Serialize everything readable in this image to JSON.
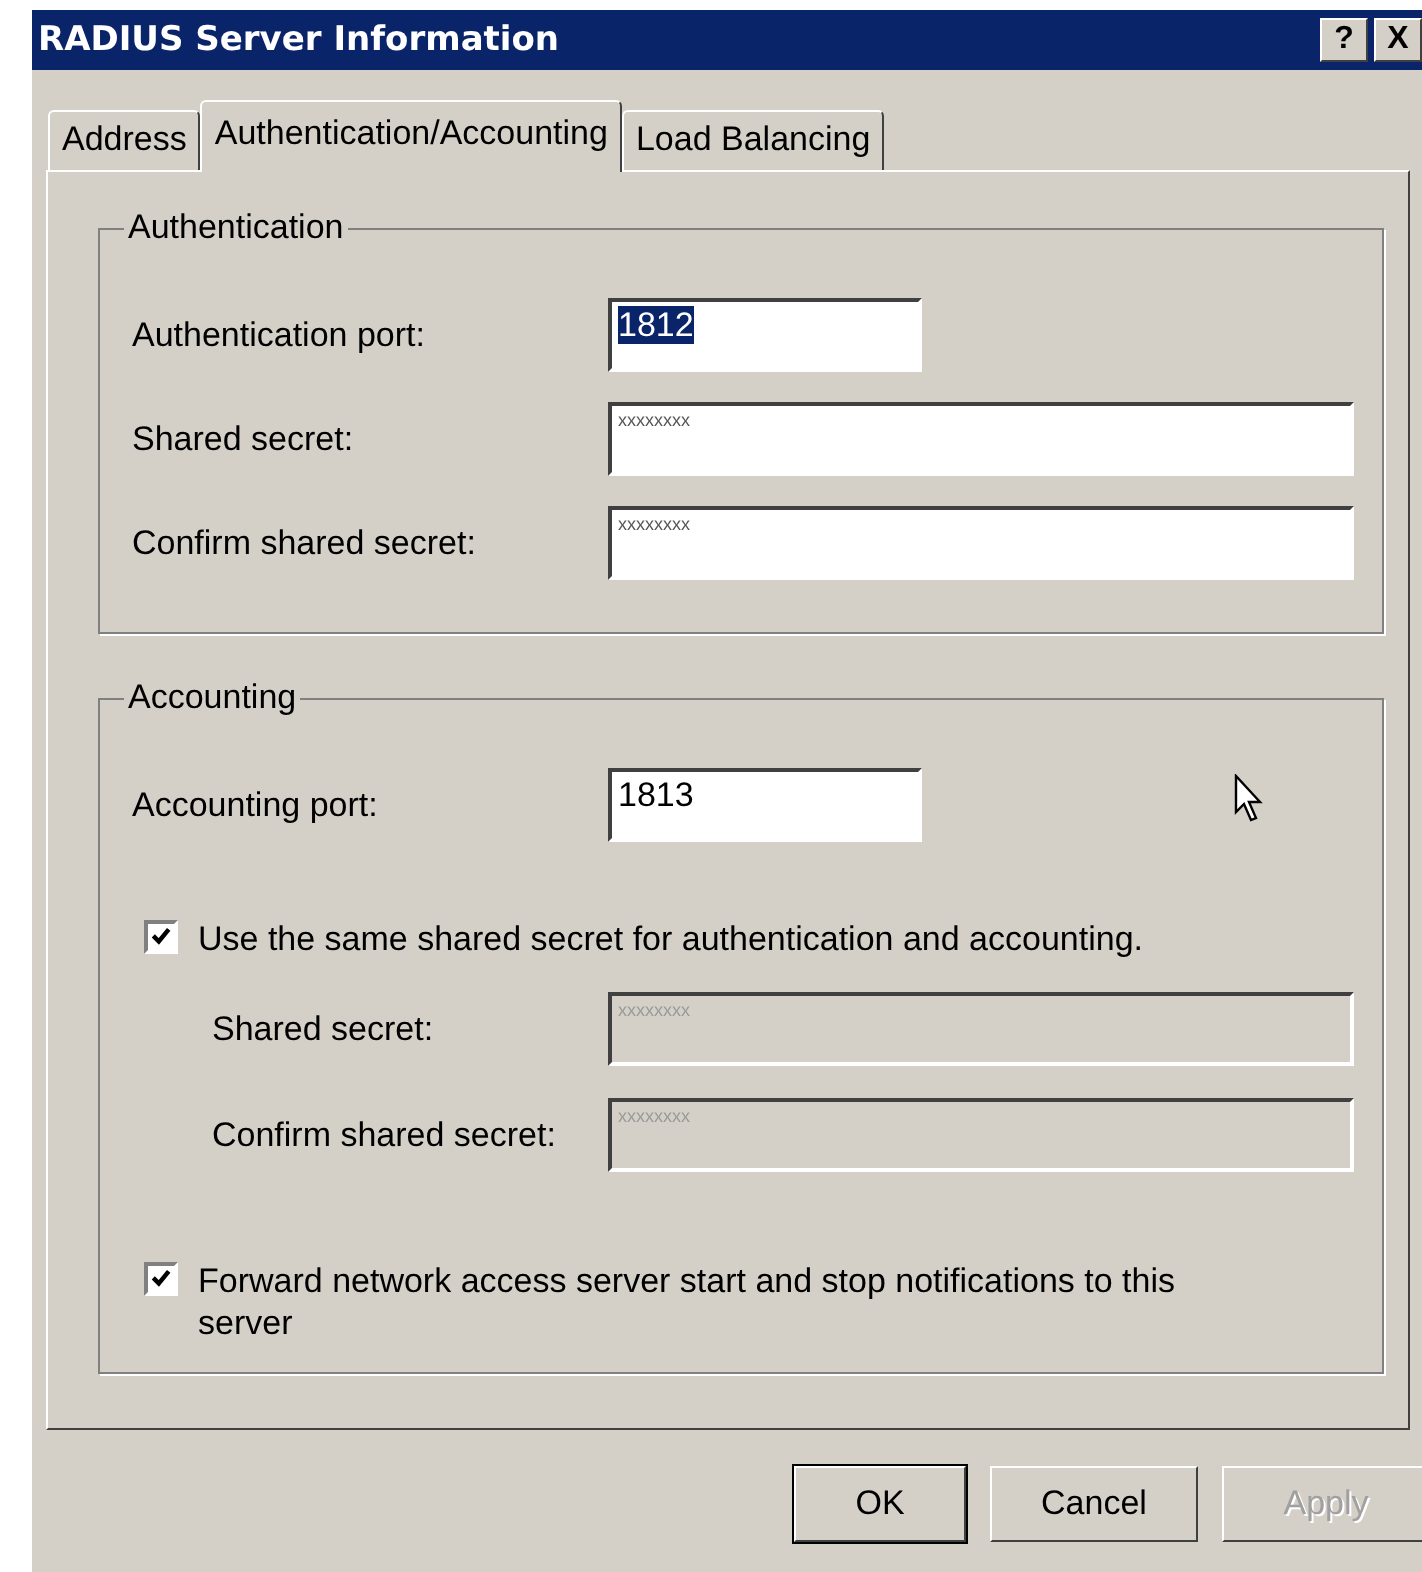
{
  "window": {
    "title": "RADIUS Server Information",
    "title_buttons": [
      "?",
      "X"
    ]
  },
  "tabs": [
    {
      "label": "Address",
      "selected": false
    },
    {
      "label": "Authentication/Accounting",
      "selected": true
    },
    {
      "label": "Load Balancing",
      "selected": false
    }
  ],
  "authentication": {
    "title": "Authentication",
    "fields": [
      {
        "label": "Authentication port:",
        "value": "1812",
        "kind": "short",
        "disabled": false,
        "highlighted": true
      },
      {
        "label": "Shared secret:",
        "value": "xxxxxxxx",
        "kind": "secret",
        "disabled": false,
        "highlighted": false
      },
      {
        "label": "Confirm shared secret:",
        "value": "xxxxxxxx",
        "kind": "secret",
        "disabled": false,
        "highlighted": false
      }
    ]
  },
  "accounting": {
    "title": "Accounting",
    "port": {
      "label": "Accounting port:",
      "value": "1813",
      "kind": "short",
      "disabled": false,
      "highlighted": false
    },
    "same_secret": {
      "label": "Use the same shared secret for authentication and accounting.",
      "checked": true
    },
    "fields": [
      {
        "label": "Shared secret:",
        "value": "xxxxxxxx",
        "kind": "secret",
        "disabled": true,
        "highlighted": false
      },
      {
        "label": "Confirm shared secret:",
        "value": "xxxxxxxx",
        "kind": "secret",
        "disabled": true,
        "highlighted": false
      }
    ],
    "forward": {
      "label": "Forward network access server start and stop notifications to this server",
      "checked": true
    }
  },
  "buttons": [
    {
      "label": "OK",
      "disabled": false,
      "default": true
    },
    {
      "label": "Cancel",
      "disabled": false,
      "default": false
    },
    {
      "label": "Apply",
      "disabled": true,
      "default": false
    }
  ]
}
